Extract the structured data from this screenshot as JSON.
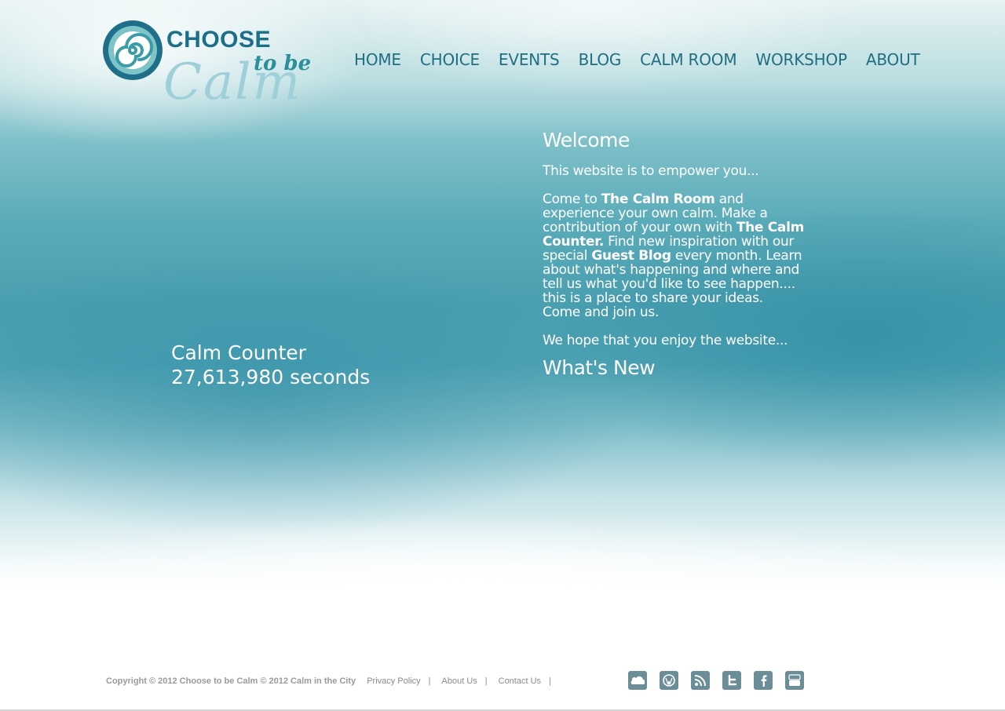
{
  "logo": {
    "line1": "CHOOSE",
    "line2": "to be",
    "line3": "Calm"
  },
  "nav": {
    "items": [
      "HOME",
      "CHOICE",
      "EVENTS",
      "BLOG",
      "CALM ROOM",
      "WORKSHOP",
      "ABOUT"
    ]
  },
  "counter": {
    "title": "Calm Counter",
    "value": "27,613,980 seconds"
  },
  "welcome": {
    "heading": "Welcome",
    "intro": "This website is to empower you...",
    "p2_a": "Come to ",
    "p2_b": "The Calm Room",
    "p2_c": " and experience your own calm. Make a contribution of your own with ",
    "p2_d": "The Calm Counter.",
    "p2_e": " Find new inspiration with our special ",
    "p2_f": "Guest Blog",
    "p2_g": " every month. Learn about what's happening and where and tell us what you'd like to see happen.... this is a place to share your ideas.",
    "p3": "Come and join us.",
    "p4": "We hope that you enjoy the website...",
    "whats_new": "What's New"
  },
  "footer": {
    "copyright": "Copyright © 2012 Choose to be Calm © 2012 Calm in the City",
    "links": [
      "Privacy Policy",
      "About Us",
      "Contact Us"
    ],
    "separator": "|"
  },
  "social": {
    "icons": [
      "soundcloud-icon",
      "wordpress-icon",
      "rss-icon",
      "twitter-icon",
      "facebook-icon",
      "youtube-icon"
    ]
  },
  "colors": {
    "nav": "#1f6e82",
    "logo_primary": "#1d6f88",
    "logo_secondary": "#9fd0d9",
    "footer_text": "#9a9a9a",
    "social_icon_bg": "#6b8d97"
  }
}
